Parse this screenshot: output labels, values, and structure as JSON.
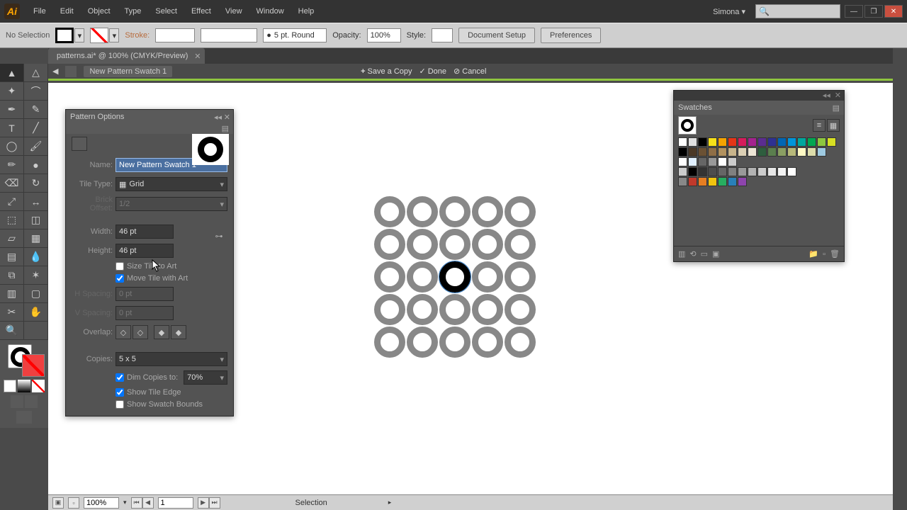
{
  "app": {
    "icon_text": "Ai"
  },
  "menu": [
    "File",
    "Edit",
    "Object",
    "Type",
    "Select",
    "Effect",
    "View",
    "Window",
    "Help"
  ],
  "user": "Simona",
  "controlbar": {
    "status": "No Selection",
    "stroke_label": "Stroke:",
    "brush": "5 pt. Round",
    "opacity_label": "Opacity:",
    "opacity": "100%",
    "style_label": "Style:",
    "doc_setup": "Document Setup",
    "prefs": "Preferences"
  },
  "doctab": {
    "title": "patterns.ai* @ 100% (CMYK/Preview)"
  },
  "patternbar": {
    "breadcrumb": "New Pattern Swatch 1",
    "save_copy": "Save a Copy",
    "done": "Done",
    "cancel": "Cancel"
  },
  "pattern_options": {
    "title": "Pattern Options",
    "name_label": "Name:",
    "name_value": "New Pattern Swatch 1",
    "tile_type_label": "Tile Type:",
    "tile_type_value": "Grid",
    "brick_offset_label": "Brick Offset:",
    "brick_offset_value": "1/2",
    "width_label": "Width:",
    "width_value": "46 pt",
    "height_label": "Height:",
    "height_value": "46 pt",
    "size_tile_label": "Size Tile to Art",
    "move_tile_label": "Move Tile with Art",
    "h_spacing_label": "H Spacing:",
    "h_spacing_value": "0 pt",
    "v_spacing_label": "V Spacing:",
    "v_spacing_value": "0 pt",
    "overlap_label": "Overlap:",
    "copies_label": "Copies:",
    "copies_value": "5 x 5",
    "dim_copies_label": "Dim Copies to:",
    "dim_copies_value": "70%",
    "show_tile_label": "Show Tile Edge",
    "show_bounds_label": "Show Swatch Bounds"
  },
  "swatches": {
    "title": "Swatches"
  },
  "swatch_colors": [
    [
      "#fff",
      "#e0e0e0",
      "#000",
      "#f7e018",
      "#f5a300",
      "#e53517",
      "#d61c5b",
      "#a4238e",
      "#5b2d90",
      "#2e3192",
      "#0066b3",
      "#0095da",
      "#00a79d",
      "#00a651",
      "#8dc63f",
      "#d7df23"
    ],
    [
      "#000",
      "#4a3826",
      "#6b5134",
      "#8f6e46",
      "#b2925f",
      "#c8b48b",
      "#dcd0b5",
      "#ede6d6",
      "#2e5e3e",
      "#5b7f4e",
      "#8b9f63",
      "#b8b97a",
      "#fff9c4",
      "#dcdcaa",
      "#9ecae1"
    ],
    [
      "#fff",
      "#e0f0ff",
      "#666",
      "#999",
      "#fff",
      "#ccc"
    ],
    [
      "#ccc",
      "#000",
      "#333",
      "#4d4d4d",
      "#666",
      "#808080",
      "#999",
      "#b3b3b3",
      "#ccc",
      "#e6e6e6",
      "#f2f2f2",
      "#fff"
    ],
    [
      "#888",
      "#c0392b",
      "#e67e22",
      "#f1c40f",
      "#27ae60",
      "#2980b9",
      "#8e44ad"
    ]
  ],
  "statusbar": {
    "zoom": "100%",
    "page": "1",
    "tool": "Selection"
  },
  "tools_left": [
    [
      "selection-tool",
      "direct-selection-tool"
    ],
    [
      "magic-wand-tool",
      "lasso-tool"
    ],
    [
      "pen-tool",
      "add-anchor-tool"
    ],
    [
      "type-tool",
      "line-tool"
    ],
    [
      "ellipse-tool",
      "paintbrush-tool"
    ],
    [
      "pencil-tool",
      "blob-brush-tool"
    ],
    [
      "eraser-tool",
      "rotate-tool"
    ],
    [
      "scale-tool",
      "width-tool"
    ],
    [
      "free-transform-tool",
      "shape-builder-tool"
    ],
    [
      "perspective-tool",
      "mesh-tool"
    ],
    [
      "gradient-tool",
      "eyedropper-tool"
    ],
    [
      "blend-tool",
      "symbol-sprayer-tool"
    ],
    [
      "column-graph-tool",
      "artboard-tool"
    ],
    [
      "slice-tool",
      "hand-tool"
    ],
    [
      "zoom-tool",
      ""
    ]
  ],
  "tool_glyphs": {
    "selection-tool": "▲",
    "direct-selection-tool": "△",
    "magic-wand-tool": "✦",
    "lasso-tool": "⌒",
    "pen-tool": "✒",
    "add-anchor-tool": "✎",
    "type-tool": "T",
    "line-tool": "╱",
    "ellipse-tool": "◯",
    "paintbrush-tool": "🖌",
    "pencil-tool": "✏",
    "blob-brush-tool": "●",
    "eraser-tool": "⌫",
    "rotate-tool": "↻",
    "scale-tool": "⤢",
    "width-tool": "↔",
    "free-transform-tool": "⬚",
    "shape-builder-tool": "◫",
    "perspective-tool": "▱",
    "mesh-tool": "▦",
    "gradient-tool": "▤",
    "eyedropper-tool": "💧",
    "blend-tool": "⧉",
    "symbol-sprayer-tool": "✶",
    "column-graph-tool": "▥",
    "artboard-tool": "▢",
    "slice-tool": "✂",
    "hand-tool": "✋",
    "zoom-tool": "🔍"
  }
}
